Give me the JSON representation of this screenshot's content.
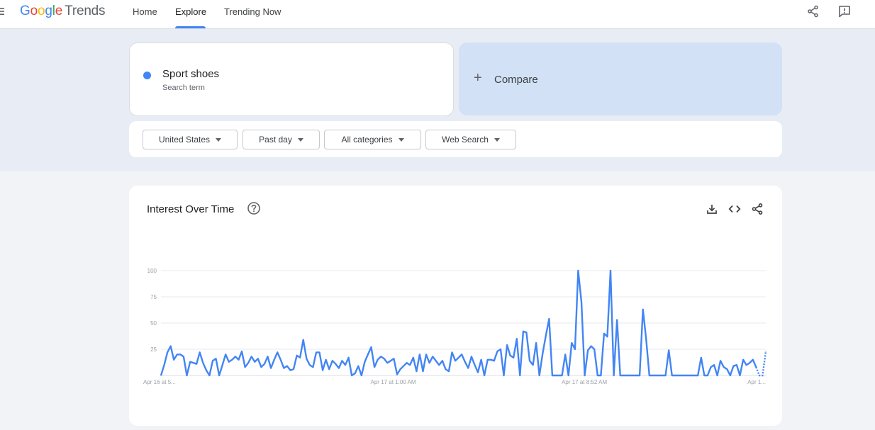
{
  "header": {
    "logo_letters": [
      "G",
      "o",
      "o",
      "g",
      "l",
      "e"
    ],
    "logo_product": "Trends",
    "nav": [
      {
        "label": "Home"
      },
      {
        "label": "Explore"
      },
      {
        "label": "Trending Now"
      }
    ],
    "active_nav": "Explore",
    "icons": [
      "menu-icon",
      "share-icon",
      "feedback-icon"
    ]
  },
  "search": {
    "term": "Sport shoes",
    "term_sub": "Search term",
    "term_color": "#4285f4",
    "compare_label": "Compare"
  },
  "filters": {
    "region": "United States",
    "time": "Past day",
    "category": "All categories",
    "property": "Web Search"
  },
  "chart_card": {
    "title": "Interest Over Time",
    "icons": [
      "help-icon",
      "download-icon",
      "embed-icon",
      "share-icon"
    ]
  },
  "chart_data": {
    "type": "line",
    "title": "Interest Over Time",
    "xlabel": "",
    "ylabel": "",
    "ylim": [
      0,
      100
    ],
    "yticks": [
      25,
      50,
      75,
      100
    ],
    "xtick_labels": [
      "Apr 16 at 5...",
      "Apr 17 at 1:00 AM",
      "Apr 17 at 8:52 AM",
      "Apr 1..."
    ],
    "grid": true,
    "series": [
      {
        "color": "#4285f4",
        "values": [
          0,
          10,
          22,
          28,
          15,
          20,
          20,
          18,
          0,
          13,
          12,
          11,
          22,
          12,
          5,
          0,
          14,
          16,
          0,
          10,
          20,
          13,
          15,
          18,
          15,
          23,
          8,
          12,
          18,
          13,
          16,
          8,
          11,
          18,
          7,
          15,
          22,
          15,
          7,
          9,
          5,
          6,
          19,
          17,
          34,
          16,
          10,
          8,
          22,
          22,
          5,
          15,
          6,
          14,
          11,
          7,
          14,
          10,
          17,
          0,
          2,
          9,
          0,
          13,
          20,
          27,
          8,
          15,
          18,
          16,
          12,
          14,
          16,
          1,
          6,
          9,
          12,
          10,
          17,
          4,
          20,
          4,
          20,
          12,
          18,
          14,
          10,
          14,
          6,
          4,
          22,
          14,
          17,
          20,
          13,
          7,
          18,
          10,
          3,
          15,
          0,
          15,
          15,
          14,
          23,
          25,
          0,
          29,
          19,
          17,
          35,
          0,
          42,
          41,
          14,
          10,
          31,
          0,
          21,
          38,
          54,
          0,
          0,
          0,
          0,
          20,
          0,
          31,
          25,
          100,
          70,
          0,
          24,
          28,
          25,
          0,
          0,
          40,
          37,
          100,
          0,
          53,
          0,
          0,
          0,
          0,
          0,
          0,
          0,
          63,
          35,
          0,
          0,
          0,
          0,
          0,
          0,
          24,
          0,
          0,
          0,
          0,
          0,
          0,
          0,
          0,
          0,
          17,
          0,
          0,
          8,
          10,
          0,
          14,
          8,
          6,
          0,
          9,
          10,
          0,
          15,
          10,
          12,
          15,
          8,
          0,
          0,
          23
        ],
        "last_points_partial": 3
      }
    ]
  }
}
